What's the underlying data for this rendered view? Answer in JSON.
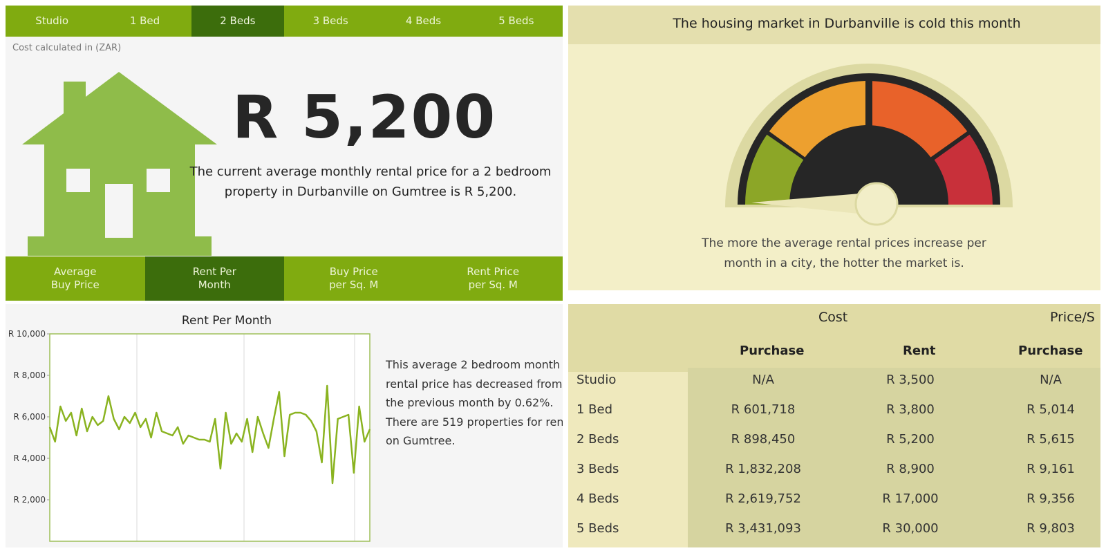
{
  "left_top": {
    "tabs": [
      "Studio",
      "1 Bed",
      "2 Beds",
      "3 Beds",
      "4 Beds",
      "5 Beds"
    ],
    "active_tab": "2 Beds",
    "currency_note": "Cost calculated in (ZAR)",
    "big_price": "R 5,200",
    "description_line1": "The current average monthly rental price for a 2 bedroom",
    "description_line2": "property in Durbanville on Gumtree is R 5,200.",
    "metrics": [
      {
        "line1": "Average",
        "line2": "Buy Price"
      },
      {
        "line1": "Rent Per",
        "line2": "Month"
      },
      {
        "line1": "Buy Price",
        "line2": "per Sq. M"
      },
      {
        "line1": "Rent Price",
        "line2": "per Sq. M"
      }
    ],
    "colors": {
      "tab_green": "#80ab10",
      "tab_dark": "#3c6d0c",
      "house": "#8fbc4a"
    }
  },
  "left_bottom": {
    "side_text": [
      "This average 2 bedroom month",
      "rental price has decreased from",
      "the previous month by 0.62%.",
      "There are 519 properties for ren",
      "on Gumtree."
    ]
  },
  "chart_data": {
    "type": "line",
    "title": "Rent Per Month",
    "xlabel": "",
    "ylabel": "",
    "ylim": [
      0,
      10000
    ],
    "ytick_labels": [
      "R 10,000",
      "R 8,000",
      "R 6,000",
      "R 4,000",
      "R 2,000"
    ],
    "yticks": [
      10000,
      8000,
      6000,
      4000,
      2000
    ],
    "grid": true,
    "series": [
      {
        "values": [
          5500,
          4800,
          6500,
          5800,
          6200,
          5100,
          6400,
          5300,
          6000,
          5600,
          5800,
          7000,
          5900,
          5400,
          6000,
          5700,
          6200,
          5500,
          5900,
          5000,
          6200,
          5300,
          5200,
          5100,
          5500,
          4700,
          5100,
          5000,
          4900,
          4900,
          4800,
          5900,
          3500,
          6200,
          4700,
          5200,
          4800,
          5900,
          4300,
          6000,
          5200,
          4500,
          5900,
          7200,
          4100,
          6100,
          6200,
          6200,
          6100,
          5800,
          5300,
          3800,
          7500,
          2800,
          5900,
          6000,
          6100,
          3300,
          6500,
          4800,
          5400
        ]
      }
    ],
    "color": "#8ab320"
  },
  "right_top": {
    "title": "The housing market in Durbanville is cold this month",
    "text_line1": "The more the average rental prices increase per",
    "text_line2": "month in a city, the hotter the market is.",
    "gauge_level": "cold",
    "gauge_colors": [
      "#8ca627",
      "#eda02f",
      "#e8622a",
      "#c8303a"
    ]
  },
  "right_bottom": {
    "group_headers": {
      "cost": "Cost",
      "price": "Price/S"
    },
    "columns": [
      "Purchase",
      "Rent",
      "Purchase"
    ],
    "rows": [
      {
        "label": "Studio",
        "purchase": "N/A",
        "rent": "R 3,500",
        "sqm": "N/A"
      },
      {
        "label": "1 Bed",
        "purchase": "R 601,718",
        "rent": "R 3,800",
        "sqm": "R 5,014"
      },
      {
        "label": "2 Beds",
        "purchase": "R 898,450",
        "rent": "R 5,200",
        "sqm": "R 5,615"
      },
      {
        "label": "3 Beds",
        "purchase": "R 1,832,208",
        "rent": "R 8,900",
        "sqm": "R 9,161"
      },
      {
        "label": "4 Beds",
        "purchase": "R 2,619,752",
        "rent": "R 17,000",
        "sqm": "R 9,356"
      },
      {
        "label": "5 Beds",
        "purchase": "R 3,431,093",
        "rent": "R 30,000",
        "sqm": "R 9,803"
      }
    ]
  }
}
